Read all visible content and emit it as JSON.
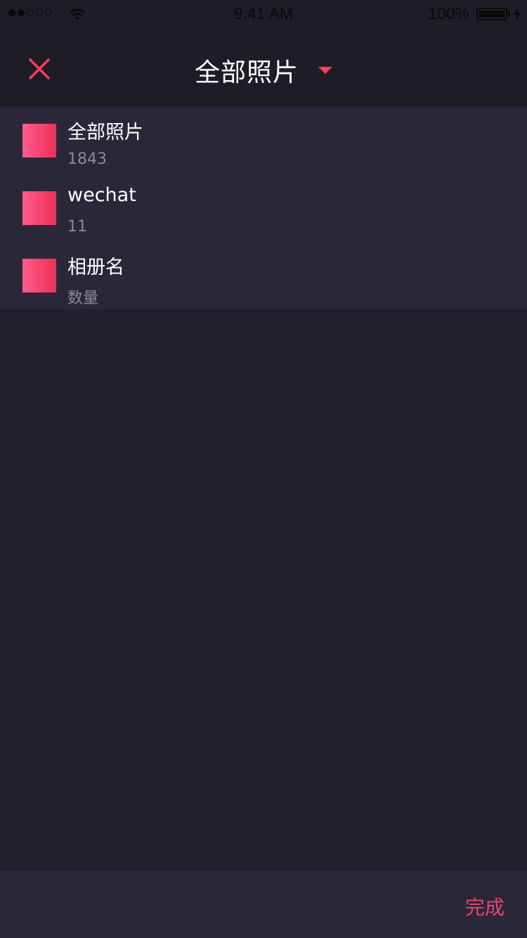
{
  "status_bar": {
    "time": "9:41 AM",
    "battery_percent": "100%",
    "signal_bars_filled": 2,
    "signal_bars_total": 5
  },
  "nav": {
    "title": "全部照片",
    "close_icon": "close-icon",
    "dropdown_icon": "caret-down-icon"
  },
  "albums": [
    {
      "name": "全部照片",
      "count": "1843"
    },
    {
      "name": "wechat",
      "count": "11"
    },
    {
      "name": "相册名",
      "count": "数量"
    }
  ],
  "bottom_bar": {
    "done_label": "完成"
  },
  "colors": {
    "accent": "#fe3a62",
    "background": "#201f2b",
    "panel": "#2a2838"
  }
}
